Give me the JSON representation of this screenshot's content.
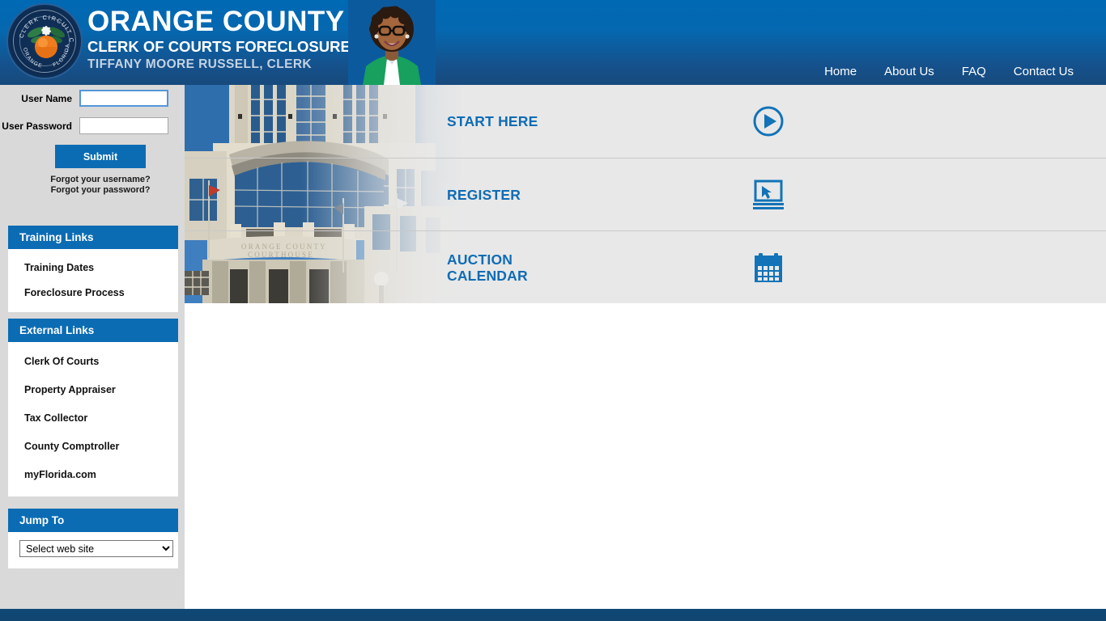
{
  "header": {
    "seal": {
      "top_text": "CLERK CIRCUIT COURT",
      "bottom_left_text": "ORANGE COUNTY",
      "bottom_right_text": "FLORIDA"
    },
    "title_main": "ORANGE COUNTY",
    "title_sub": "CLERK OF COURTS FORECLOSURE SALES",
    "title_clerk": "TIFFANY MOORE RUSSELL, CLERK",
    "nav": [
      {
        "label": "Home"
      },
      {
        "label": "About Us"
      },
      {
        "label": "FAQ"
      },
      {
        "label": "Contact Us"
      }
    ]
  },
  "login": {
    "username_label": "User Name",
    "username_value": "",
    "username_placeholder": "",
    "password_label": "User Password",
    "password_value": "",
    "password_placeholder": "",
    "submit_label": "Submit",
    "forgot_username": "Forgot your username?",
    "forgot_password": "Forgot your password?"
  },
  "sidebar": {
    "sections": [
      {
        "title": "Training Links",
        "items": [
          {
            "label": "Training Dates"
          },
          {
            "label": "Foreclosure Process"
          }
        ]
      },
      {
        "title": "External Links",
        "items": [
          {
            "label": "Clerk Of Courts"
          },
          {
            "label": "Property Appraiser"
          },
          {
            "label": "Tax Collector"
          },
          {
            "label": "County Comptroller"
          },
          {
            "label": "myFlorida.com"
          }
        ]
      }
    ],
    "jump_to": {
      "title": "Jump To",
      "selected": "Select web site",
      "options": [
        "Select web site"
      ]
    }
  },
  "hero": {
    "image_caption": "ORANGE COUNTY COURTHOUSE",
    "rows": [
      {
        "label": "START HERE",
        "icon": "play-circle-icon"
      },
      {
        "label": "REGISTER",
        "icon": "monitor-cursor-icon"
      },
      {
        "label": "AUCTION CALENDAR",
        "icon": "calendar-icon"
      }
    ]
  },
  "colors": {
    "header_top": "#0069b4",
    "header_bottom": "#174a7c",
    "accent_blue": "#0b6cb3",
    "link_blue": "#0f6cb5",
    "panel_gray": "#d9d9d9",
    "hero_gray": "#e8e8e8",
    "footer_blue": "#0e4876"
  }
}
